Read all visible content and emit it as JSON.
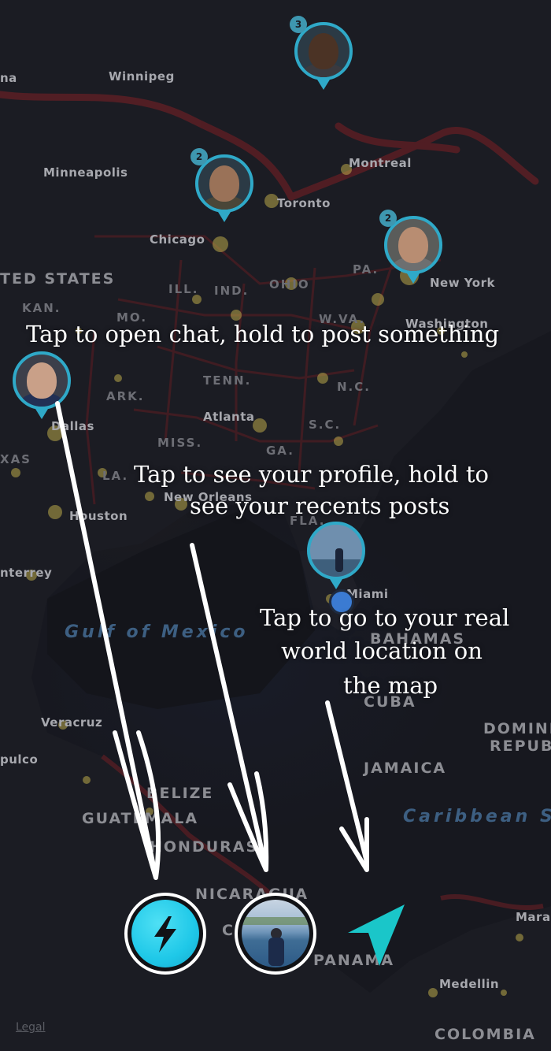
{
  "map": {
    "cities": {
      "winnipeg": "Winnipeg",
      "minneapolis": "Minneapolis",
      "montreal": "Montreal",
      "toronto": "Toronto",
      "chicago": "Chicago",
      "new_york": "New York",
      "washington": "Washington",
      "atlanta": "Atlanta",
      "dallas": "Dallas",
      "new_orleans": "New Orleans",
      "houston": "Houston",
      "miami": "Miami",
      "monterrey": "nterrey",
      "veracruz": "Veracruz",
      "acapulco": "pulco",
      "medellin": "Medellin",
      "mara": "Mara",
      "na": "na"
    },
    "regions": {
      "ill": "ILL.",
      "ind": "IND.",
      "ohio": "OHIO",
      "pa": "PA.",
      "kan": "KAN.",
      "mo": "MO.",
      "wva": "W.VA.",
      "tenn": "TENN.",
      "ark": "ARK.",
      "nc": "N.C.",
      "sc": "S.C.",
      "miss": "MISS.",
      "ga": "GA.",
      "la": "LA.",
      "fla": "FLA.",
      "xas": "XAS"
    },
    "countries": {
      "united_states": "TED STATES",
      "bahamas": "BAHAMAS",
      "cuba": "CUBA",
      "jamaica": "JAMAICA",
      "dominican": "DOMINIC",
      "republic": "REPUBL",
      "belize": "BELIZE",
      "guatemala": "GUATEMALA",
      "honduras": "HONDURAS",
      "nicaragua": "NICARAGUA",
      "panama": "PANAMA",
      "colombia": "COLOMBIA",
      "costa_rica": "CO"
    },
    "seas": {
      "gulf": "Gulf of Mexico",
      "caribbean": "Caribbean S"
    },
    "legal": "Legal"
  },
  "pins": [
    {
      "badge": "3"
    },
    {
      "badge": "2"
    },
    {
      "badge": "2"
    }
  ],
  "annotations": {
    "chat": "Tap to open chat, hold to post something",
    "profile_line1": "Tap to see your profile, hold to",
    "profile_line2": "see your recents posts",
    "location_line1": "Tap to go to your real",
    "location_line2": "world location on",
    "location_line3": "the map"
  },
  "colors": {
    "accent": "#2fa9c8",
    "chat_button": "#1fc8e8",
    "location_arrow": "#1ac6c9",
    "arrow": "#ffffff"
  },
  "controls": {
    "chat_icon": "lightning-bolt-icon",
    "profile_icon": "avatar",
    "location_icon": "navigation-arrow-icon"
  }
}
